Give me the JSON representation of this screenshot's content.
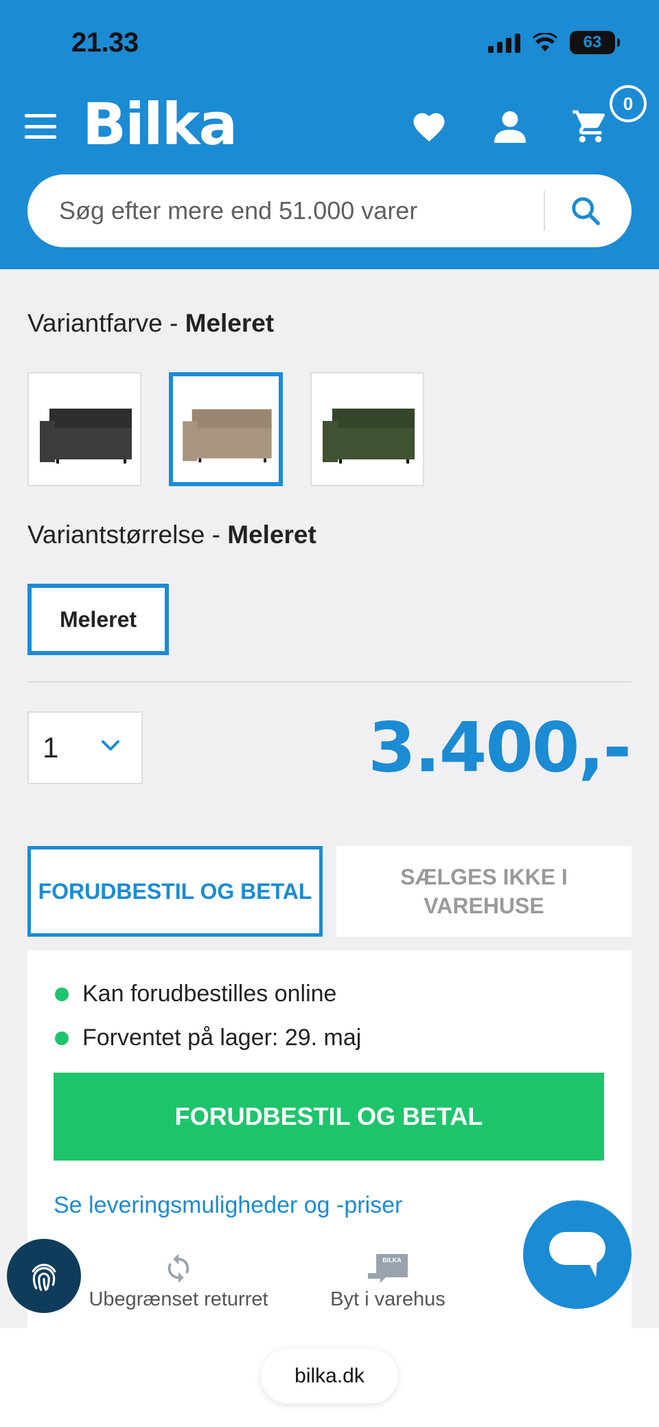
{
  "status_bar": {
    "time": "21.33",
    "battery": "63"
  },
  "header": {
    "logo": "Bilka",
    "cart_count": "0",
    "search_placeholder": "Søg efter mere end 51.000 varer"
  },
  "variant_color": {
    "label": "Variantfarve - ",
    "value": "Meleret",
    "swatches": [
      {
        "name": "dark-grey",
        "color": "#3a3d3c",
        "selected": false
      },
      {
        "name": "beige",
        "color": "#a8957e",
        "selected": true
      },
      {
        "name": "green",
        "color": "#3f5232",
        "selected": false
      }
    ]
  },
  "variant_size": {
    "label": "Variantstørrelse - ",
    "value": "Meleret",
    "option": "Meleret"
  },
  "quantity": "1",
  "price": "3.400,-",
  "tabs": {
    "active": "FORUDBESTIL OG BETAL",
    "inactive": "SÆLGES IKKE I VAREHUSE"
  },
  "panel": {
    "status_1": "Kan forudbestilles online",
    "status_2": "Forventet på lager: 29. maj",
    "cta": "FORUDBESTIL OG BETAL",
    "delivery_link": "Se leveringsmuligheder og -priser",
    "feature_1": "Ubegrænset returret",
    "feature_2": "Byt i varehus",
    "feature_2_badge": "BILKA"
  },
  "colors": {
    "brand_blue": "#1b8bd4",
    "success_green": "#1ec46b"
  },
  "browser": {
    "url": "bilka.dk"
  }
}
